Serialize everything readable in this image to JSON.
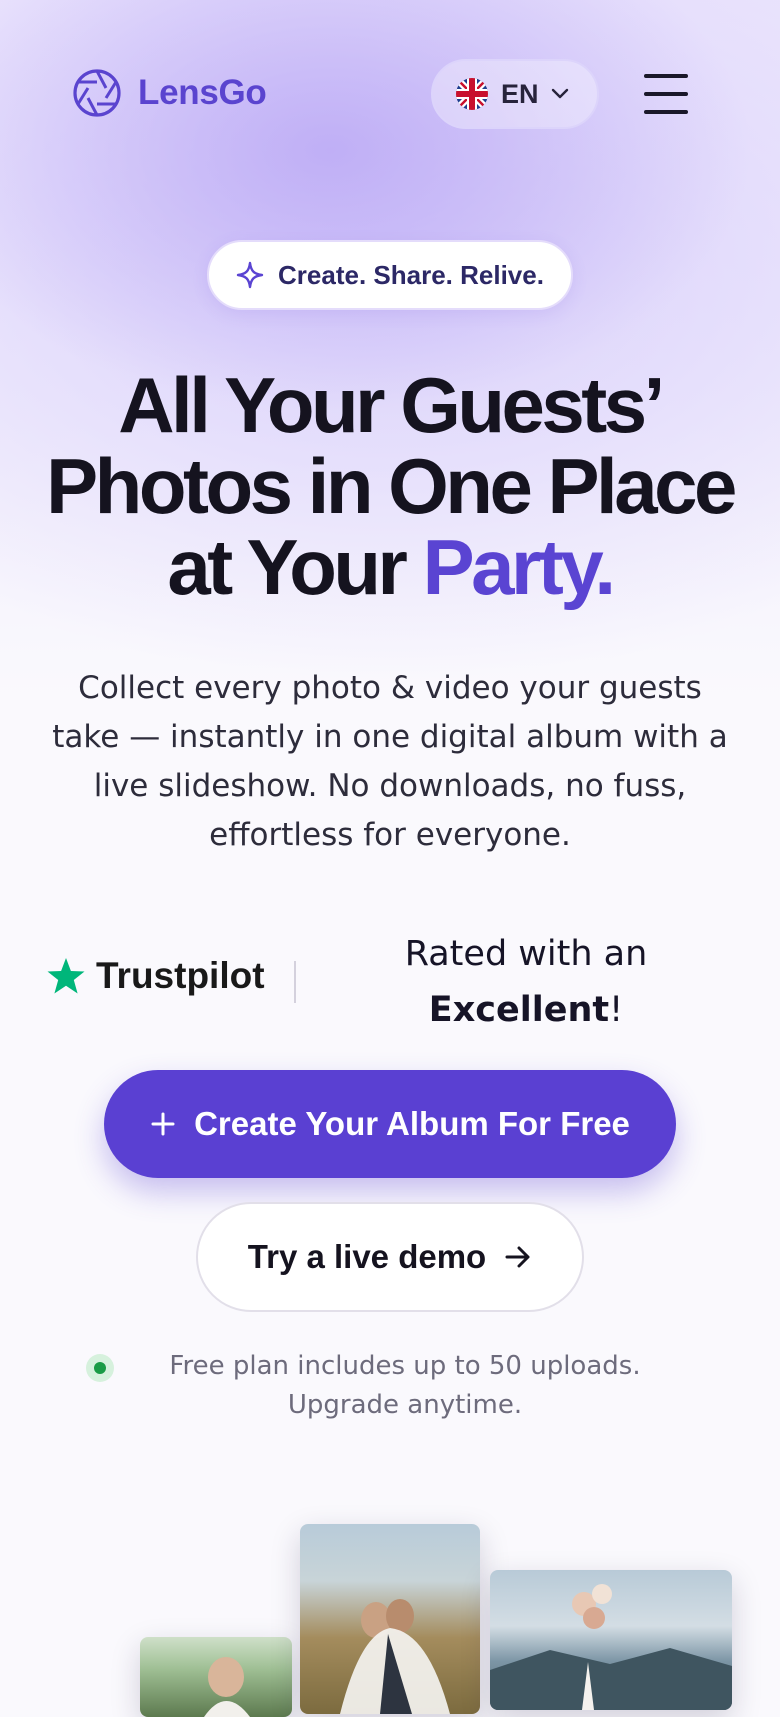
{
  "header": {
    "logo_text": "LensGo",
    "language": {
      "code": "EN",
      "flag": "uk-flag"
    },
    "menu_icon": "hamburger-menu-icon"
  },
  "hero": {
    "tagline": "Create. Share. Relive.",
    "tagline_icon": "sparkle-icon",
    "headline_line1": "All Your Guests’",
    "headline_line2": "Photos in One Place",
    "headline_line3_prefix": "at Your",
    "headline_line3_accent": "Party.",
    "description": "Collect every photo & video your guests take — instantly in one digital album with a live slideshow. No downloads, no fuss, effortless for everyone."
  },
  "trust": {
    "brand": "Trustpilot",
    "rating_prefix": "Rated with an",
    "rating_value": "Excellent",
    "rating_suffix": "!"
  },
  "actions": {
    "primary_label": "Create Your Album For Free",
    "secondary_label": "Try a live demo"
  },
  "note": "Free plan includes up to 50 uploads. Upgrade anytime.",
  "colors": {
    "accent": "#5a40d2",
    "trustpilot_green": "#00b67a",
    "status_green": "#1a9b46"
  }
}
